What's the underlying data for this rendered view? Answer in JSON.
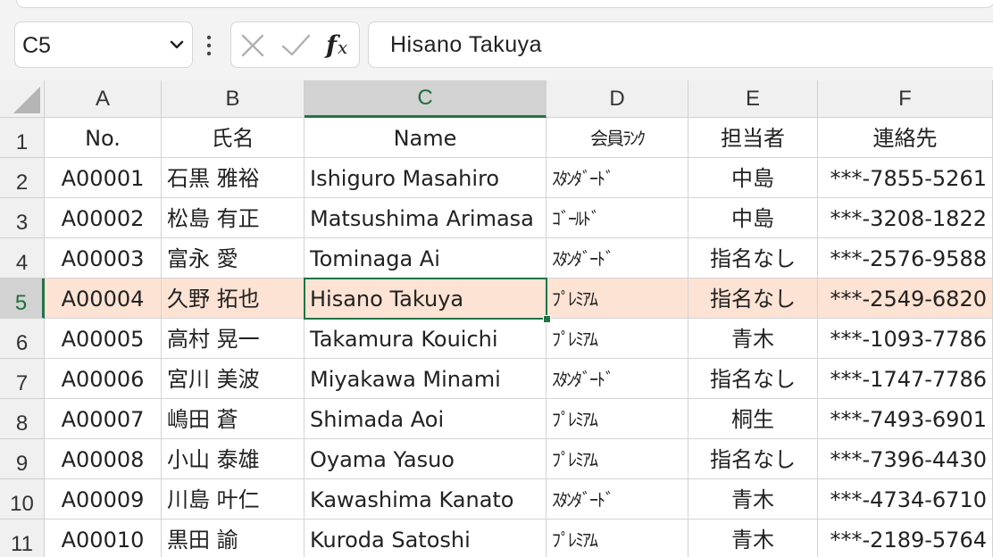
{
  "formula_bar": {
    "name_box": "C5",
    "formula": "Hisano Takuya"
  },
  "icons": {
    "cancel": "x-icon",
    "enter": "check-icon",
    "function": "fx-icon",
    "dropdown": "chevron-down-icon",
    "more": "vertical-dots-icon"
  },
  "columns": [
    "A",
    "B",
    "C",
    "D",
    "E",
    "F"
  ],
  "selected_column": "C",
  "selected_row": 5,
  "rows": [
    {
      "num": "1",
      "cells": [
        "No.",
        "氏名",
        "Name",
        "会員ﾗﾝｸ",
        "担当者",
        "連絡先"
      ]
    },
    {
      "num": "2",
      "cells": [
        "A00001",
        "石黒 雅裕",
        "Ishiguro Masahiro",
        "ｽﾀﾝﾀﾞｰﾄﾞ",
        "中島",
        "***-7855-5261"
      ]
    },
    {
      "num": "3",
      "cells": [
        "A00002",
        "松島 有正",
        "Matsushima Arimasa",
        "ｺﾞｰﾙﾄﾞ",
        "中島",
        "***-3208-1822"
      ]
    },
    {
      "num": "4",
      "cells": [
        "A00003",
        "富永 愛",
        "Tominaga Ai",
        "ｽﾀﾝﾀﾞｰﾄﾞ",
        "指名なし",
        "***-2576-9588"
      ]
    },
    {
      "num": "5",
      "cells": [
        "A00004",
        "久野 拓也",
        "Hisano Takuya",
        "ﾌﾟﾚﾐｱﾑ",
        "指名なし",
        "***-2549-6820"
      ]
    },
    {
      "num": "6",
      "cells": [
        "A00005",
        "高村 晃一",
        "Takamura Kouichi",
        "ﾌﾟﾚﾐｱﾑ",
        "青木",
        "***-1093-7786"
      ]
    },
    {
      "num": "7",
      "cells": [
        "A00006",
        "宮川 美波",
        "Miyakawa Minami",
        "ｽﾀﾝﾀﾞｰﾄﾞ",
        "指名なし",
        "***-1747-7786"
      ]
    },
    {
      "num": "8",
      "cells": [
        "A00007",
        "嶋田 蒼",
        "Shimada Aoi",
        "ﾌﾟﾚﾐｱﾑ",
        "桐生",
        "***-7493-6901"
      ]
    },
    {
      "num": "9",
      "cells": [
        "A00008",
        "小山 泰雄",
        "Oyama Yasuo",
        "ﾌﾟﾚﾐｱﾑ",
        "指名なし",
        "***-7396-4430"
      ]
    },
    {
      "num": "10",
      "cells": [
        "A00009",
        "川島 叶仁",
        "Kawashima Kanato",
        "ｽﾀﾝﾀﾞｰﾄﾞ",
        "青木",
        "***-4734-6710"
      ]
    },
    {
      "num": "11",
      "cells": [
        "A00010",
        "黒田 諭",
        "Kuroda Satoshi",
        "ﾌﾟﾚﾐｱﾑ",
        "青木",
        "***-2189-5764"
      ]
    }
  ]
}
